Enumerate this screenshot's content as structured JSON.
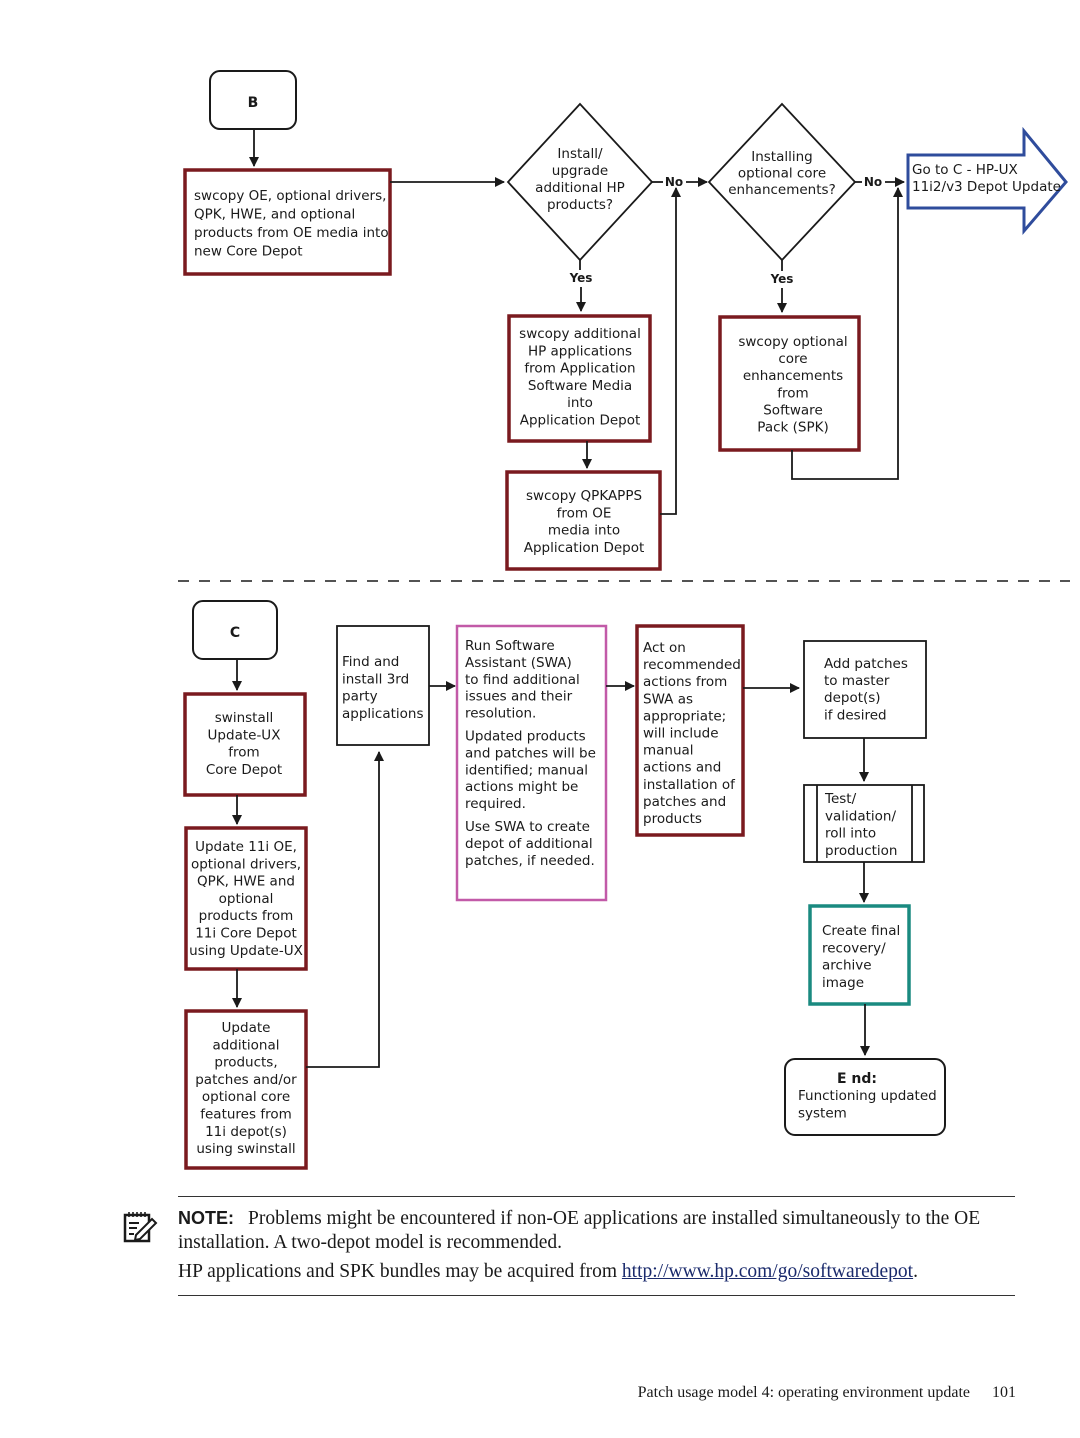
{
  "colors": {
    "process_border": "#7a1a1f",
    "goto_border": "#2f4c9c",
    "swa_border": "#c25aa8",
    "archive_border": "#1a8a80",
    "line": "#1a1a1a"
  },
  "section_b": {
    "start_label": "B",
    "swcopy_oe": [
      "swcopy OE, optional drivers,",
      "QPK, HWE, and optional",
      "products from OE media into",
      "new Core Depot"
    ],
    "decision_install_hp": [
      "Install/",
      "upgrade",
      "additional HP",
      "products?"
    ],
    "decision_core_enh": [
      "Installing",
      "optional core",
      "enhancements?"
    ],
    "no_label": "No",
    "yes_label": "Yes",
    "goto_c": [
      "Go to C - HP-UX",
      "11i2/v3 Depot Update"
    ],
    "swcopy_apps": [
      "swcopy additional",
      "HP applications",
      "from Application",
      "Software Media",
      "into",
      "Application Depot"
    ],
    "swcopy_qpkapps": [
      "swcopy QPKAPPS",
      "from OE",
      "media into",
      "Application Depot"
    ],
    "swcopy_spk": [
      "swcopy optional",
      "core",
      "enhancements",
      "from",
      "Software",
      "Pack (SPK)"
    ]
  },
  "section_c": {
    "start_label": "C",
    "swinstall_updateux": [
      "swinstall",
      "Update-UX",
      "from",
      "Core Depot"
    ],
    "update_11i_oe": [
      "Update 11i OE,",
      "optional drivers,",
      "QPK, HWE and",
      "optional",
      "products from",
      "11i Core Depot",
      "using Update-UX"
    ],
    "update_additional": [
      "Update",
      "additional",
      "products,",
      "patches and/or",
      "optional core",
      "features from",
      "11i depot(s)",
      "using swinstall"
    ],
    "find_3rd_party": [
      "Find and",
      "install 3rd",
      "party",
      "applications"
    ],
    "run_swa": [
      "Run Software",
      "Assistant (SWA)",
      "to find additional",
      "issues and their",
      "resolution.",
      "",
      "Updated products",
      "and patches will be",
      "identified; manual",
      "actions might be",
      "required.",
      "",
      "Use SWA to create",
      "depot of additional",
      "patches, if needed."
    ],
    "act_on_swa": [
      "Act on",
      "recommended",
      "actions from",
      "SWA as",
      "appropriate;",
      "will include",
      "manual",
      "actions and",
      "installation of",
      "patches and",
      "products"
    ],
    "add_patches": [
      "Add patches",
      "to master",
      "depot(s)",
      "if desired"
    ],
    "test_validation": [
      "Test/",
      "validation/",
      "roll into",
      "production"
    ],
    "create_archive": [
      "Create final",
      "recovery/",
      "archive",
      "image"
    ],
    "end_title": "E nd:",
    "end_text": [
      "Functioning updated",
      "system"
    ]
  },
  "note": {
    "label": "NOTE:",
    "text": "Problems might be encountered if non-OE applications are installed simultaneously to the OE installation. A two-depot model is recommended.",
    "text2_prefix": "HP applications and SPK bundles may be acquired from ",
    "link": "http://www.hp.com/go/softwaredepot",
    "text2_suffix": "."
  },
  "footer": {
    "title": "Patch usage model 4: operating environment update",
    "page_number": "101"
  }
}
